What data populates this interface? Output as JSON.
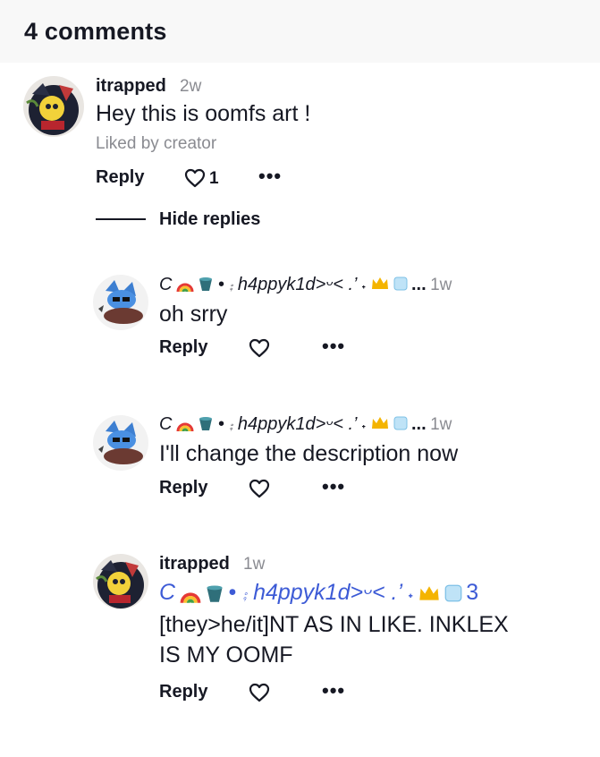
{
  "header": {
    "title": "4 comments"
  },
  "comments": [
    {
      "username": "itrapped",
      "time": "2w",
      "text": "Hey this is oomfs art !",
      "liked_by": "Liked by creator",
      "reply_label": "Reply",
      "like_count": "1",
      "more": "•••",
      "hide_replies": "Hide replies"
    },
    {
      "username_prefix": "Ϲ",
      "username": "• ⨾ h4ppyk1d>ᵕ< .’ ˖",
      "username_suffix": "...",
      "time": "1w",
      "text": "oh srry",
      "reply_label": "Reply",
      "more": "•••"
    },
    {
      "username_prefix": "Ϲ",
      "username": "• ⨾ h4ppyk1d>ᵕ< .’ ˖",
      "username_suffix": "...",
      "time": "1w",
      "text": "I'll change the description now",
      "reply_label": "Reply",
      "more": "•••"
    },
    {
      "username": "itrapped",
      "time": "1w",
      "mention_prefix": "Ϲ",
      "mention": "• ⨾ h4ppyk1d>ᵕ< .’ ˖",
      "mention_suffix": "3",
      "text_line1": "[they>he/it]NT AS IN LIKE. INKLEX",
      "text_line2": "IS MY OOMF",
      "reply_label": "Reply",
      "more": "•••"
    }
  ],
  "colors": {
    "mention": "#3d5bd6",
    "muted": "#8a8b91",
    "text": "#161823"
  },
  "icons": [
    "heart-icon",
    "more-icon",
    "rainbow-emoji",
    "bucket-emoji",
    "crown-emoji",
    "ice-cube-emoji"
  ]
}
